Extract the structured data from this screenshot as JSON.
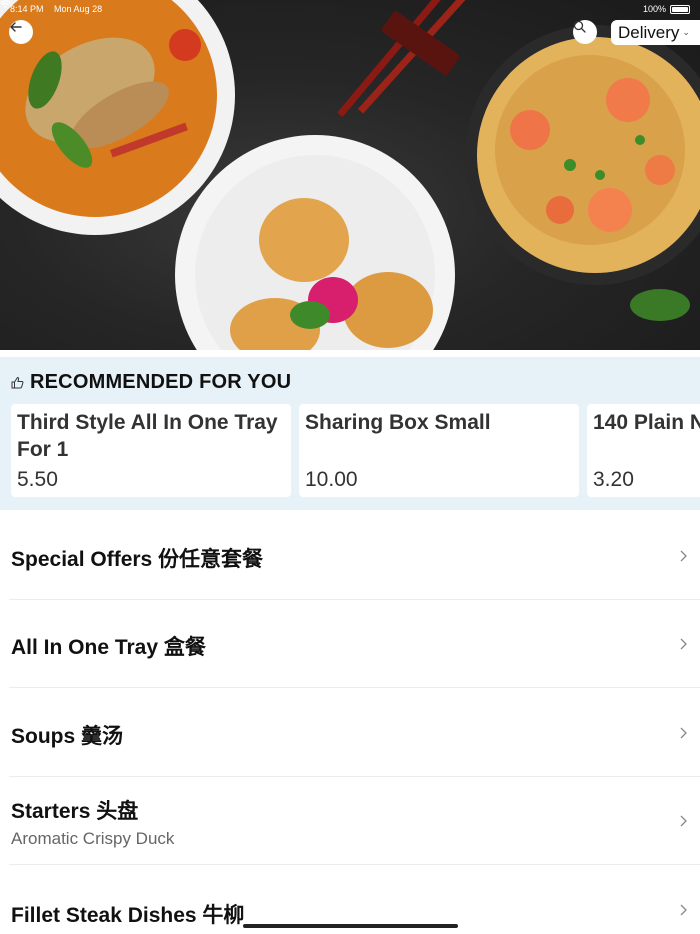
{
  "status_bar": {
    "time": "8:14 PM",
    "date": "Mon Aug 28",
    "battery": "100%"
  },
  "header": {
    "order_type": "Delivery"
  },
  "icons": {
    "back": "arrow-left-icon",
    "search": "search-icon",
    "dropdown": "chevron-down-icon",
    "recommended": "thumbs-up-icon",
    "row": "chevron-right-icon"
  },
  "colors": {
    "recommended_bg": "#e6f1f8",
    "text": "#111111",
    "muted": "#666666"
  },
  "recommended": {
    "title": "RECOMMENDED FOR YOU",
    "items": [
      {
        "name": "Third Style All In One Tray For 1",
        "price": "5.50"
      },
      {
        "name": "Sharing Box Small",
        "price": "10.00"
      },
      {
        "name": "140 Plain N",
        "price": "3.20"
      }
    ]
  },
  "categories": [
    {
      "title": "Special Offers 份任意套餐",
      "subtitle": ""
    },
    {
      "title": "All In One Tray 盒餐",
      "subtitle": ""
    },
    {
      "title": "Soups 羹汤",
      "subtitle": ""
    },
    {
      "title": "Starters 头盘",
      "subtitle": "Aromatic Crispy Duck"
    },
    {
      "title": "Fillet Steak Dishes 牛柳",
      "subtitle": ""
    }
  ]
}
